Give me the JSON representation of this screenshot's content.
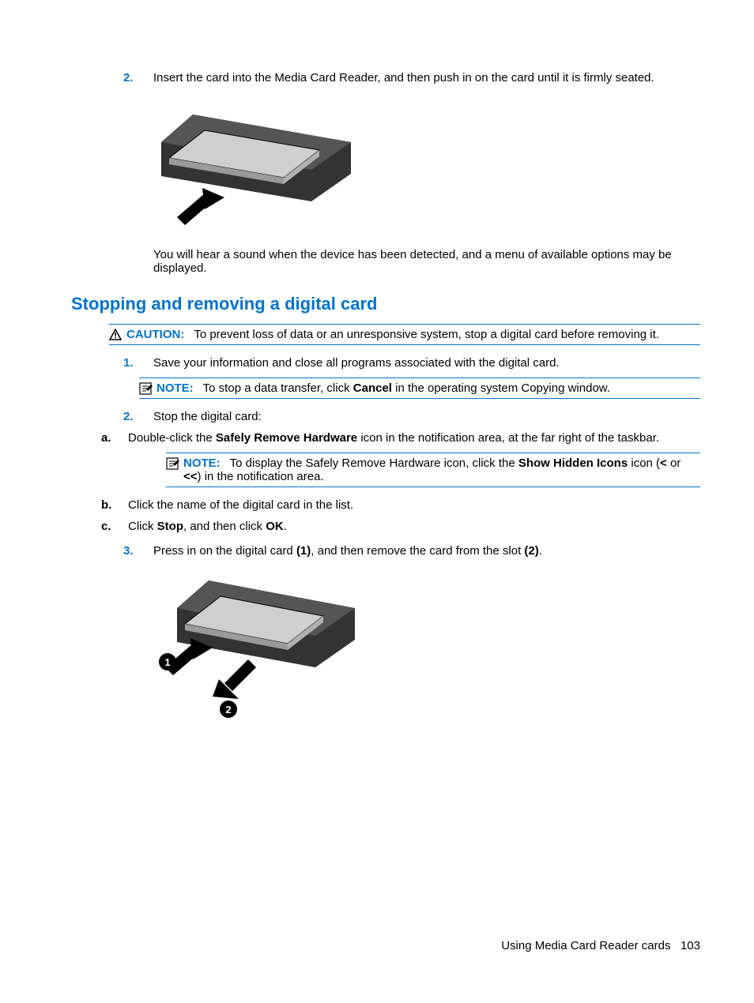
{
  "step2_insert": {
    "marker": "2.",
    "text": "Insert the card into the Media Card Reader, and then push in on the card until it is firmly seated."
  },
  "sound_text": "You will hear a sound when the device has been detected, and a menu of available options may be displayed.",
  "section_heading": "Stopping and removing a digital card",
  "caution": {
    "label": "CAUTION:",
    "text": "To prevent loss of data or an unresponsive system, stop a digital card before removing it."
  },
  "step1_save": {
    "marker": "1.",
    "text": "Save your information and close all programs associated with the digital card."
  },
  "note1": {
    "label": "NOTE:",
    "prefix": "To stop a data transfer, click ",
    "bold": "Cancel",
    "suffix": " in the operating system Copying window."
  },
  "step2_stop": {
    "marker": "2.",
    "text": "Stop the digital card:"
  },
  "sub_a": {
    "marker": "a.",
    "prefix": "Double-click the ",
    "bold": "Safely Remove Hardware",
    "suffix": " icon in the notification area, at the far right of the taskbar."
  },
  "note2": {
    "label": "NOTE:",
    "prefix": "To display the Safely Remove Hardware icon, click the ",
    "bold": "Show Hidden Icons",
    "suffix1": " icon (",
    "lt": "<",
    "or": " or ",
    "ltlt": "<<",
    "suffix2": ") in the notification area."
  },
  "sub_b": {
    "marker": "b.",
    "text": "Click the name of the digital card in the list."
  },
  "sub_c": {
    "marker": "c.",
    "prefix": "Click ",
    "bold1": "Stop",
    "mid": ", and then click ",
    "bold2": "OK",
    "suffix": "."
  },
  "step3_press": {
    "marker": "3.",
    "prefix": "Press in on the digital card ",
    "bold1": "(1)",
    "mid": ", and then remove the card from the slot ",
    "bold2": "(2)",
    "suffix": "."
  },
  "footer": {
    "text": "Using Media Card Reader cards",
    "page": "103"
  }
}
